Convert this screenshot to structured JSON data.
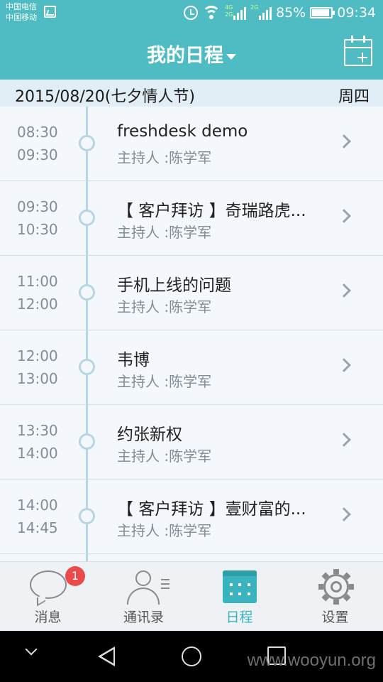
{
  "status_bar": {
    "carrier_1": "中国电信",
    "carrier_2": "中国移动",
    "net_tag_top": "4G",
    "net_tag_bottom": "2G",
    "net_tag_2": "2G",
    "battery": "85%",
    "time": "09:34"
  },
  "header": {
    "title": "我的日程",
    "add_icon": "calendar-add-icon"
  },
  "date_header": {
    "date": "2015/08/20(七夕情人节)",
    "weekday": "周四"
  },
  "events": [
    {
      "start": "08:30",
      "end": "09:30",
      "title": "freshdesk demo",
      "host": "主持人 :陈学军"
    },
    {
      "start": "09:30",
      "end": "10:30",
      "title": "【 客户拜访 】奇瑞路虎...",
      "host": "主持人 :陈学军"
    },
    {
      "start": "11:00",
      "end": "12:00",
      "title": "手机上线的问题",
      "host": "主持人 :陈学军"
    },
    {
      "start": "12:00",
      "end": "13:00",
      "title": "韦博",
      "host": "主持人 :陈学军"
    },
    {
      "start": "13:30",
      "end": "14:00",
      "title": "约张新权",
      "host": "主持人 :陈学军"
    },
    {
      "start": "14:00",
      "end": "14:45",
      "title": "【 客户拜访 】壹财富的...",
      "host": "主持人 :陈学军"
    }
  ],
  "tabs": [
    {
      "label": "消息",
      "icon": "chat-bubble-icon",
      "badge": "1"
    },
    {
      "label": "通讯录",
      "icon": "contacts-icon"
    },
    {
      "label": "日程",
      "icon": "calendar-icon",
      "active": true
    },
    {
      "label": "设置",
      "icon": "gear-icon"
    }
  ],
  "nav_bar": {
    "watermark": "www.wooyun.org"
  },
  "colors": {
    "accent": "#4fbcc4",
    "active_tab": "#3ab3c0",
    "badge": "#e94b4b"
  }
}
